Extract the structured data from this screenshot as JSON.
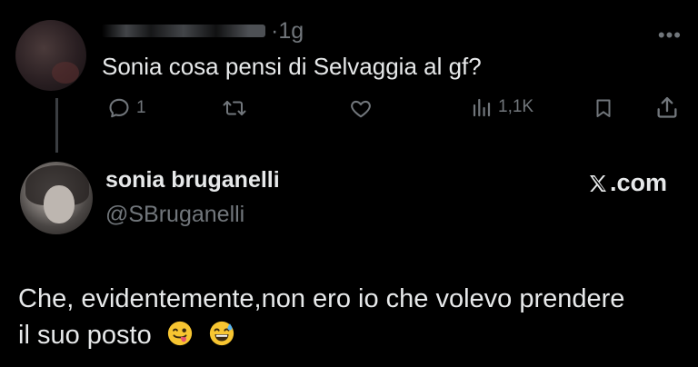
{
  "original_tweet": {
    "time": "1g",
    "text": "Sonia cosa pensi di Selvaggia al gf?",
    "more_icon": "more-horizontal-icon",
    "actions": {
      "reply_count": "1",
      "retweet_count": "",
      "like_count": "",
      "views_count": "1,1K"
    }
  },
  "reply": {
    "display_name": "sonia bruganelli",
    "handle": "@SBruganelli",
    "brand": "X.com",
    "text_line1": "Che, evidentemente,non ero io che volevo prendere",
    "text_line2": "il suo posto",
    "emojis": [
      "winking-tongue-face",
      "grinning-sweat-face"
    ]
  },
  "colors": {
    "background": "#000000",
    "text_primary": "#e7e9ea",
    "text_secondary": "#71767b",
    "thread_line": "#3a3d41"
  }
}
